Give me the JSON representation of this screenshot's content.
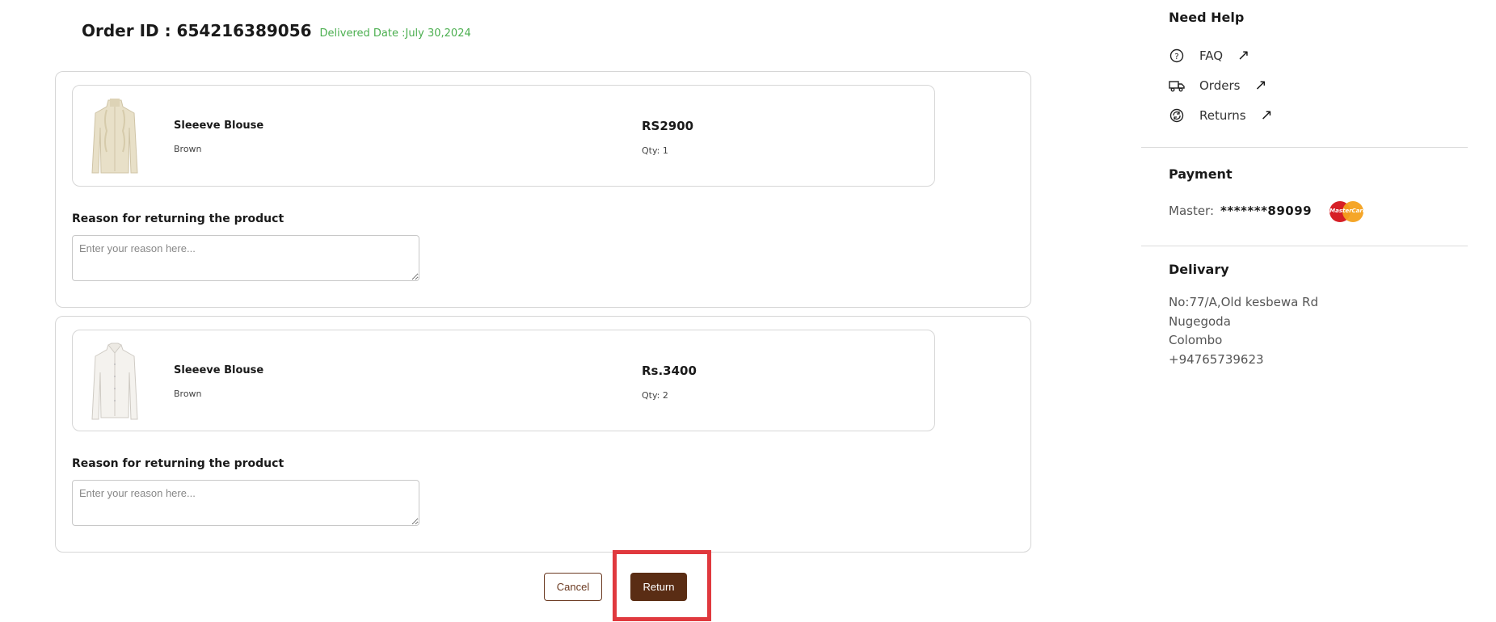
{
  "order": {
    "id_label": "Order ID : 654216389056",
    "delivered_label": "Delivered Date :July 30,2024"
  },
  "items": [
    {
      "name": "Sleeeve Blouse",
      "color": "Brown",
      "price": "RS2900",
      "qty": "Qty: 1",
      "reason_label": "Reason for returning the product",
      "reason_placeholder": "Enter your reason here...",
      "thumb_icon": "blouse-beige-icon"
    },
    {
      "name": "Sleeeve Blouse",
      "color": "Brown",
      "price": "Rs.3400",
      "qty": "Qty: 2",
      "reason_label": "Reason for returning the product",
      "reason_placeholder": "Enter your reason here...",
      "thumb_icon": "blouse-white-icon"
    }
  ],
  "actions": {
    "cancel_label": "Cancel",
    "return_label": "Return"
  },
  "help": {
    "title": "Need Help",
    "links": [
      {
        "label": "FAQ",
        "icon": "question-circle-icon"
      },
      {
        "label": "Orders",
        "icon": "truck-icon"
      },
      {
        "label": "Returns",
        "icon": "return-icon"
      }
    ]
  },
  "payment": {
    "title": "Payment",
    "method_label": "Master:",
    "masked_number": "*******89099",
    "card_icon": "mastercard-icon",
    "card_text": "MasterCard"
  },
  "delivery": {
    "title": "Delivary",
    "address_lines": [
      "No:77/A,Old kesbewa Rd",
      "Nugegoda",
      "Colombo",
      "+94765739623"
    ]
  },
  "colors": {
    "accent": "#5a2d14",
    "delivered_green": "#4caf50",
    "highlight_red": "#e0393e"
  }
}
